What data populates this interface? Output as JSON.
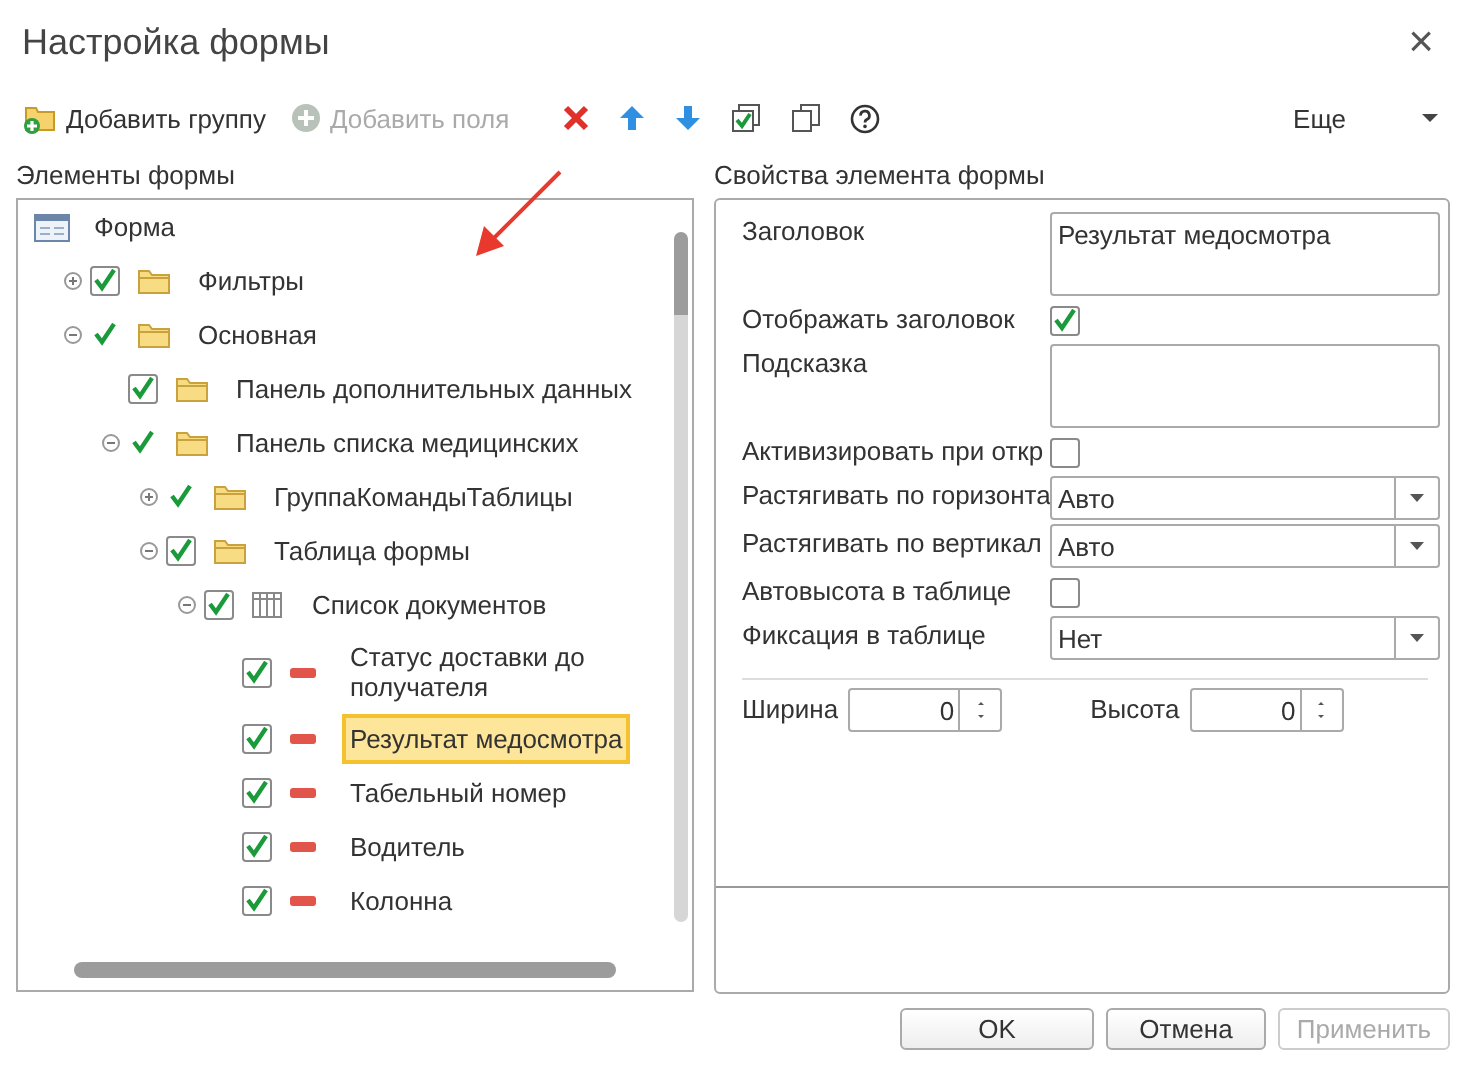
{
  "window": {
    "title": "Настройка формы",
    "close": "×"
  },
  "toolbar": {
    "add_group": {
      "label": "Добавить группу",
      "disabled": false
    },
    "add_fields": {
      "label": "Добавить поля",
      "disabled": true
    },
    "more": "Еще"
  },
  "tree": {
    "title": "Элементы формы",
    "items": [
      {
        "label": "Форма",
        "kind": "form",
        "selected": false,
        "children": [
          {
            "label": "Фильтры",
            "kind": "folder",
            "boxed": true,
            "checked": true,
            "expanded": false,
            "selected": false
          },
          {
            "label": "Основная",
            "kind": "folder",
            "boxed": false,
            "checked": true,
            "expanded": true,
            "selected": false,
            "children": [
              {
                "label": "Панель дополнительных данных",
                "kind": "folder",
                "boxed": true,
                "checked": true,
                "selected": false
              },
              {
                "label": "Панель списка медицинских",
                "kind": "folder",
                "boxed": false,
                "checked": true,
                "expanded": true,
                "selected": false,
                "children": [
                  {
                    "label": "ГруппаКомандыТаблицы",
                    "kind": "folder",
                    "boxed": false,
                    "checked": true,
                    "expanded": false,
                    "selected": false
                  },
                  {
                    "label": "Таблица формы",
                    "kind": "folder",
                    "boxed": true,
                    "checked": true,
                    "expanded": true,
                    "selected": false,
                    "children": [
                      {
                        "label": "Список документов",
                        "kind": "table",
                        "boxed": true,
                        "checked": true,
                        "expanded": true,
                        "selected": false,
                        "children": [
                          {
                            "label": "Статус доставки до получателя",
                            "kind": "field",
                            "boxed": true,
                            "checked": true,
                            "selected": false
                          },
                          {
                            "label": "Результат медосмотра",
                            "kind": "field",
                            "boxed": true,
                            "checked": true,
                            "selected": true
                          },
                          {
                            "label": "Табельный номер",
                            "kind": "field",
                            "boxed": true,
                            "checked": true,
                            "selected": false
                          },
                          {
                            "label": "Водитель",
                            "kind": "field",
                            "boxed": true,
                            "checked": true,
                            "selected": false
                          },
                          {
                            "label": "Колонна",
                            "kind": "field",
                            "boxed": true,
                            "checked": true,
                            "selected": false
                          }
                        ]
                      }
                    ]
                  }
                ]
              }
            ]
          }
        ]
      }
    ]
  },
  "properties": {
    "title": "Свойства элемента формы",
    "rows": [
      {
        "kind": "textarea",
        "label": "Заголовок",
        "value": "Результат медосмотра"
      },
      {
        "kind": "checkbox",
        "label": "Отображать заголовок",
        "checked": true
      },
      {
        "kind": "textarea",
        "label": "Подсказка"
      },
      {
        "kind": "checkbox",
        "label": "Активизировать при откр",
        "checked": false
      },
      {
        "kind": "select",
        "label": "Растягивать по горизонта",
        "value": "Авто"
      },
      {
        "kind": "select",
        "label": "Растягивать по вертикал",
        "value": "Авто"
      },
      {
        "kind": "checkbox",
        "label": "Автовысота в таблице",
        "checked": false
      },
      {
        "kind": "select",
        "label": "Фиксация в таблице",
        "value": "Нет"
      }
    ],
    "spins": [
      {
        "label": "Ширина",
        "value": "0"
      },
      {
        "label": "Высота",
        "value": "0"
      }
    ]
  },
  "buttons": [
    {
      "label": "OK",
      "disabled": false
    },
    {
      "label": "Отмена",
      "disabled": false
    },
    {
      "label": "Применить",
      "disabled": true
    }
  ]
}
